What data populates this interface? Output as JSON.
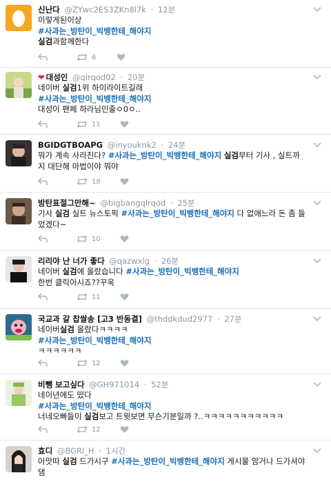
{
  "tweets": [
    {
      "name": "신난다",
      "handle": "@ZYwc2ES3ZKn8l7k",
      "time": "12분",
      "lines": [
        [
          {
            "t": "이렇게된이상",
            "s": ""
          }
        ],
        [
          {
            "t": "#사과는_방탄이_빅뱅한테_해야지",
            "s": "hashtag"
          }
        ],
        [
          {
            "t": "실검",
            "s": "bold"
          },
          {
            "t": "과함께한다",
            "s": ""
          }
        ]
      ],
      "reply": "",
      "retweet": "6",
      "like": ""
    },
    {
      "name": "대성인",
      "handle": "@qlrqod02",
      "time": "20분",
      "lines": [
        [
          {
            "t": "네이버 ",
            "s": ""
          },
          {
            "t": "실검",
            "s": "bold"
          },
          {
            "t": "1위 하이라이트길래",
            "s": ""
          }
        ],
        [
          {
            "t": "#사과는_방탄이_빅뱅한테_해야지",
            "s": "hashtag"
          }
        ],
        [
          {
            "t": "대성이 팬페 하라님인줄ㅇ0ㅇ..",
            "s": ""
          }
        ]
      ],
      "reply": "",
      "retweet": "11",
      "like": ""
    },
    {
      "name": "BGIDGTBOAPG",
      "handle": "@inyouknk2",
      "time": "24분",
      "lines": [
        [
          {
            "t": "뭐가 계속 사라진다? ",
            "s": ""
          },
          {
            "t": "#사과는_방탄이_빅뱅한테_해야지",
            "s": "hashtag"
          },
          {
            "t": " ",
            "s": ""
          },
          {
            "t": "실검",
            "s": "bold"
          },
          {
            "t": "부터 기사 , 실트까",
            "s": ""
          }
        ],
        [
          {
            "t": "지 대단해 마법이야 뭐야",
            "s": ""
          }
        ]
      ],
      "reply": "",
      "retweet": "18",
      "like": ""
    },
    {
      "name": "방탄표절그만해~",
      "handle": "@bigbangqlrqod",
      "time": "25분",
      "lines": [
        [
          {
            "t": "기사 ",
            "s": ""
          },
          {
            "t": "실검",
            "s": "bold"
          },
          {
            "t": " 실트 뉴스토픽 ",
            "s": ""
          },
          {
            "t": "#사과는_방탄이_빅뱅한테_해야지",
            "s": "hashtag"
          },
          {
            "t": " 다 없애느라 돈 좀 들",
            "s": ""
          }
        ],
        [
          {
            "t": "었겠다~",
            "s": ""
          }
        ]
      ],
      "reply": "",
      "retweet": "10",
      "like": ""
    },
    {
      "name": "리리야 난 너가 좋다",
      "handle": "@qazwxlg",
      "time": "26분",
      "lines": [
        [
          {
            "t": "네이버 ",
            "s": ""
          },
          {
            "t": "실검",
            "s": "bold"
          },
          {
            "t": "에 올랐습니다 ",
            "s": ""
          },
          {
            "t": "#사과는_방탄이_빅뱅한테_해야지",
            "s": "hashtag"
          }
        ],
        [
          {
            "t": "한번 클릭아시죠??꾸욱",
            "s": ""
          }
        ]
      ],
      "reply": "",
      "retweet": "11",
      "like": ""
    },
    {
      "name": "국교과 갈 찹쌀송 [고3 반동결]",
      "handle": "@thddkdud2977",
      "time": "27분",
      "lines": [
        [
          {
            "t": "네이버",
            "s": ""
          },
          {
            "t": "실검",
            "s": "bold"
          },
          {
            "t": " 올랐다ㅋㅋㅋㅋ",
            "s": ""
          }
        ],
        [
          {
            "t": "#사과는_방탄이_빅뱅한테_해야지",
            "s": "hashtag"
          }
        ],
        [
          {
            "t": "ㅋㅋㅋㅋㅋㅋ",
            "s": ""
          }
        ]
      ],
      "reply": "",
      "retweet": "12",
      "like": ""
    },
    {
      "name": "비뺑 보고싶다",
      "handle": "@GH971014",
      "time": "52분",
      "lines": [
        [
          {
            "t": "네이년에도 떴다",
            "s": ""
          }
        ],
        [
          {
            "t": "#사과는_방탄이_빅뱅한테_해야지",
            "s": "hashtag"
          }
        ],
        [
          {
            "t": "너네오빠들이 ",
            "s": ""
          },
          {
            "t": "실검",
            "s": "bold"
          },
          {
            "t": "보고 트윗보면 무슨기분일까 ?..ㅋㅋㅋㅋㅋㅋㅋㅋㅋㅋㅋ",
            "s": ""
          }
        ]
      ],
      "reply": "",
      "retweet": "12",
      "like": ""
    },
    {
      "name": "효디",
      "handle": "@BGRI_H",
      "time": "1시간",
      "lines": [
        [
          {
            "t": "아맛따 ",
            "s": ""
          },
          {
            "t": "실검",
            "s": "bold"
          },
          {
            "t": " 드가시구 ",
            "s": ""
          },
          {
            "t": "#사과는_방탄이_빅뱅한테_해야지",
            "s": "hashtag"
          },
          {
            "t": " 게시물 암거나 드가셔야",
            "s": ""
          }
        ],
        [
          {
            "t": "댐",
            "s": ""
          }
        ]
      ],
      "reply": "",
      "retweet": "",
      "like": ""
    }
  ],
  "icons": {
    "reply": "reply-icon",
    "retweet": "retweet-icon",
    "like": "heart-icon",
    "more": "chevron-down-icon",
    "badge": "red-heart-icon"
  },
  "colors": {
    "hashtag": "#1b6fb3",
    "muted": "#8899a6",
    "heart": "#e0245e",
    "background": "#f5f8fa"
  }
}
